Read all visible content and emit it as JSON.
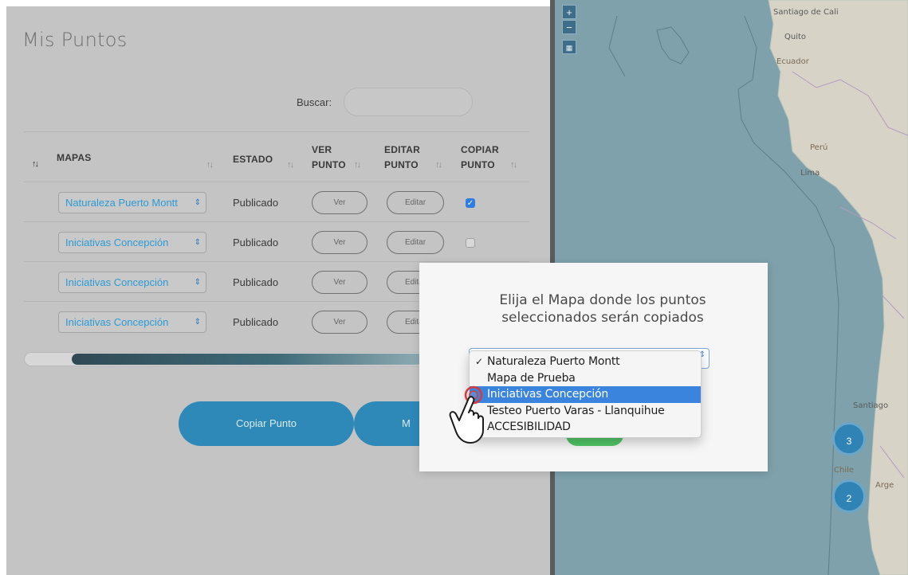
{
  "panel": {
    "title": "Mis Puntos",
    "search": {
      "label": "Buscar:",
      "value": "",
      "placeholder": ""
    }
  },
  "table": {
    "headers": {
      "select_sort": "↑↓",
      "maps": "MAPAS",
      "status": "ESTADO",
      "view_line1": "VER",
      "view_line2": "PUNTO",
      "edit_line1": "EDITAR",
      "edit_line2": "PUNTO",
      "copy_line1": "COPIAR",
      "copy_line2": "PUNTO",
      "sort_icon": "↑↓"
    },
    "rows": [
      {
        "map": "Naturaleza Puerto Montt",
        "status": "Publicado",
        "view": "Ver",
        "edit": "Editar",
        "copy_checked": true
      },
      {
        "map": "Iniciativas Concepción",
        "status": "Publicado",
        "view": "Ver",
        "edit": "Editar",
        "copy_checked": false
      },
      {
        "map": "Iniciativas Concepción",
        "status": "Publicado",
        "view": "Ver",
        "edit": "Editar",
        "copy_checked": false
      },
      {
        "map": "Iniciativas Concepción",
        "status": "Publicado",
        "view": "Ver",
        "edit": "Editar",
        "copy_checked": false
      }
    ],
    "select_caret": "⇕",
    "check_mark": "✓"
  },
  "actions": {
    "copy_label": "Copiar Punto",
    "second_label": "M"
  },
  "map": {
    "zoom_in": "+",
    "zoom_out": "−",
    "layers_icon": "map-icon",
    "labels": [
      "Santiago de Cali",
      "Quito",
      "Ecuador",
      "Perú",
      "Lima",
      "Santiago",
      "Chile",
      "Arge"
    ],
    "clusters": [
      "3",
      "2"
    ],
    "colors": {
      "sea": "#7ea1ab",
      "land": "#d6d2c5",
      "cluster": "#2f83b5"
    }
  },
  "modal": {
    "title_line1": "Elija el Mapa donde los puntos",
    "title_line2": "seleccionados serán copiados",
    "options": [
      {
        "label": "Naturaleza Puerto Montt",
        "checked": true,
        "highlighted": false
      },
      {
        "label": "Mapa de Prueba",
        "checked": false,
        "highlighted": false
      },
      {
        "label": "Iniciativas Concepción",
        "checked": false,
        "highlighted": true
      },
      {
        "label": "Testeo Puerto Varas - Llanquihue",
        "checked": false,
        "highlighted": false
      },
      {
        "label": "ACCESIBILIDAD",
        "checked": false,
        "highlighted": false
      }
    ],
    "accent": "#3b84dd"
  }
}
